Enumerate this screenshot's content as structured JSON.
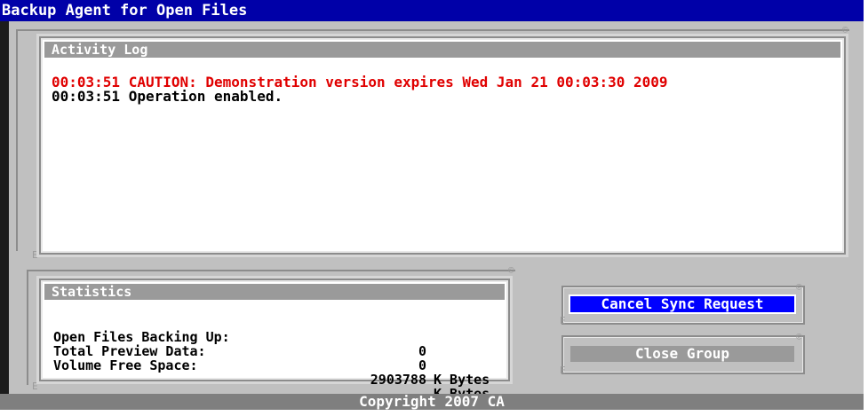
{
  "app": {
    "title": "Backup Agent for Open Files",
    "copyright": "Copyright 2007 CA"
  },
  "activity_log": {
    "heading": "Activity Log",
    "entries": [
      {
        "text": "00:03:51 CAUTION: Demonstration version expires Wed Jan 21 00:03:30 2009",
        "color": "#e00000"
      },
      {
        "text": "00:03:51 Operation enabled.",
        "color": "#000000"
      }
    ]
  },
  "statistics": {
    "heading": "Statistics",
    "rows": [
      {
        "label": "Open Files Backing Up:",
        "value": "0",
        "unit": ""
      },
      {
        "label": "Total Preview Data:",
        "value": "0",
        "unit": "K Bytes"
      },
      {
        "label": "Volume Free Space:",
        "value": "2903788",
        "unit": "K Bytes"
      }
    ]
  },
  "buttons": {
    "cancel_sync": "Cancel Sync Request",
    "close_group": "Close Group"
  },
  "corner_marks": {
    "top": "©",
    "edge": "E"
  },
  "colors": {
    "title_bg": "#0000a8",
    "caution": "#e00000",
    "selected_button": "#0000ff",
    "disabled_button": "#9a9a9a"
  }
}
